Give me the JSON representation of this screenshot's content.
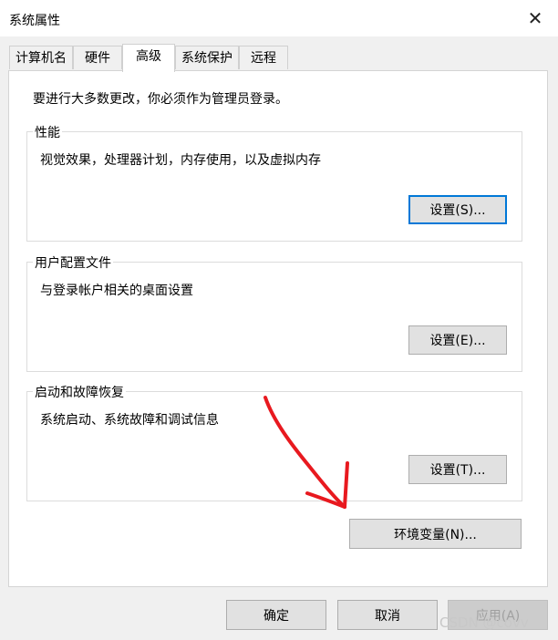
{
  "window": {
    "title": "系统属性",
    "close_glyph": "✕"
  },
  "tabs": [
    {
      "label": "计算机名",
      "active": false
    },
    {
      "label": "硬件",
      "active": false
    },
    {
      "label": "高级",
      "active": true
    },
    {
      "label": "系统保护",
      "active": false
    },
    {
      "label": "远程",
      "active": false
    }
  ],
  "admin_note": "要进行大多数更改，你必须作为管理员登录。",
  "groups": {
    "performance": {
      "title": "性能",
      "description": "视觉效果，处理器计划，内存使用，以及虚拟内存",
      "button": "设置(S)..."
    },
    "user_profiles": {
      "title": "用户配置文件",
      "description": "与登录帐户相关的桌面设置",
      "button": "设置(E)..."
    },
    "startup_recovery": {
      "title": "启动和故障恢复",
      "description": "系统启动、系统故障和调试信息",
      "button": "设置(T)..."
    }
  },
  "env_button": "环境变量(N)...",
  "footer": {
    "ok": "确定",
    "cancel": "取消",
    "apply": "应用(A)"
  },
  "watermark": "CSDN @covv",
  "colors": {
    "focus": "#0078d7",
    "annotation_arrow": "#e8191f",
    "panel": "#ffffff",
    "window": "#f0f0f0"
  }
}
